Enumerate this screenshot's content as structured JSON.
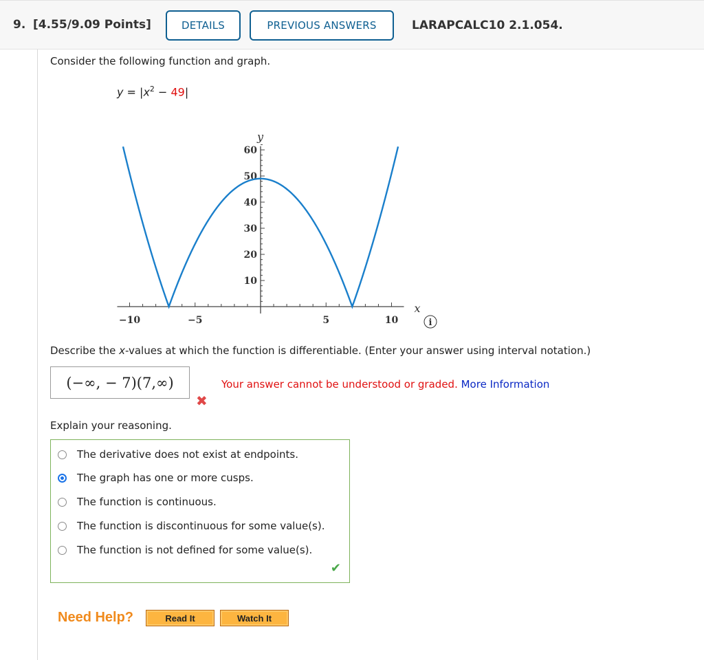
{
  "header": {
    "question_number": "9.",
    "points": "[4.55/9.09 Points]",
    "details_label": "DETAILS",
    "previous_answers_label": "PREVIOUS ANSWERS",
    "problem_code": "LARAPCALC10 2.1.054."
  },
  "prompt": {
    "intro": "Consider the following function and graph.",
    "function_prefix": "y = |x",
    "function_exponent": "2",
    "function_minus": " − ",
    "function_constant": "49",
    "function_suffix": "|"
  },
  "graph": {
    "info_icon": "info-icon",
    "curve_color": "#1a7fcb"
  },
  "chart_data": {
    "type": "line",
    "title": "",
    "function": "y = |x^2 - 49|",
    "xlabel": "x",
    "ylabel": "y",
    "xlim": [
      -11,
      11
    ],
    "ylim": [
      0,
      63
    ],
    "x_ticks": [
      -10,
      -5,
      5,
      10
    ],
    "x_tick_labels": [
      "−10",
      "−5",
      "5",
      "10"
    ],
    "y_ticks": [
      10,
      20,
      30,
      40,
      50,
      60
    ],
    "y_tick_labels": [
      "10",
      "20",
      "30",
      "40",
      "50",
      "60"
    ],
    "domain_plotted": [
      -10.5,
      10.5
    ],
    "cusps": [
      [
        -7,
        0
      ],
      [
        7,
        0
      ]
    ],
    "vertex": [
      0,
      49
    ],
    "grid": false,
    "legend": "none"
  },
  "question1": {
    "text_before": "Describe the ",
    "text_var": "x",
    "text_after": "-values at which the function is differentiable. (Enter your answer using interval notation.)",
    "answer_value": "(−∞, − 7)(7,∞)",
    "result_icon": "x-mark-icon",
    "error_text": "Your answer cannot be understood or graded. ",
    "more_info_link": "More Information"
  },
  "question2": {
    "label": "Explain your reasoning.",
    "options": [
      {
        "label": "The derivative does not exist at endpoints.",
        "selected": false
      },
      {
        "label": "The graph has one or more cusps.",
        "selected": true
      },
      {
        "label": "The function is continuous.",
        "selected": false
      },
      {
        "label": "The function is discontinuous for some value(s).",
        "selected": false
      },
      {
        "label": "The function is not defined for some value(s).",
        "selected": false
      }
    ],
    "result_icon": "check-icon"
  },
  "help": {
    "label": "Need Help?",
    "read_it": "Read It",
    "watch_it": "Watch It"
  },
  "colors": {
    "header_button": "#0e5f91",
    "error": "#e01010",
    "link": "#0a28c4",
    "correct_border": "#7db25a",
    "need_help": "#f08a1c",
    "help_button": "#fdb540"
  }
}
